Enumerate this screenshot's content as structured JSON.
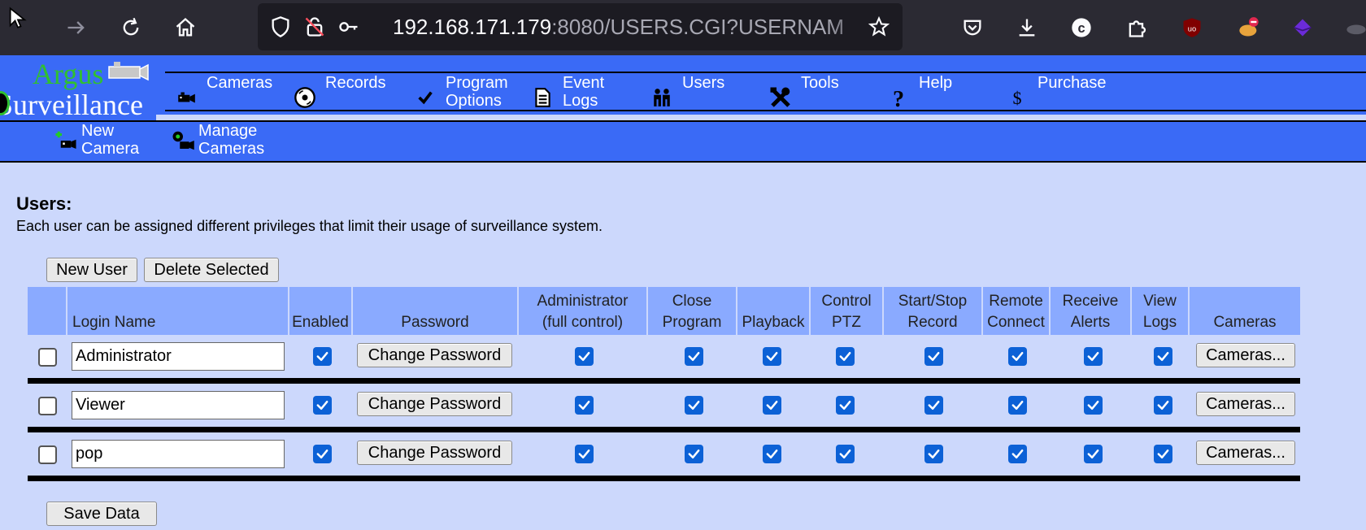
{
  "browser": {
    "url_host": "192.168.171.179",
    "url_path": ":8080/USERS.CGI?USERNAM"
  },
  "app": {
    "logo_line1": "Argus",
    "logo_line2": "Surveillance"
  },
  "nav": {
    "main": [
      {
        "label1": "Cameras",
        "label2": ""
      },
      {
        "label1": "Records",
        "label2": ""
      },
      {
        "label1": "Program",
        "label2": "Options"
      },
      {
        "label1": "Event",
        "label2": "Logs"
      },
      {
        "label1": "Users",
        "label2": ""
      },
      {
        "label1": "Tools",
        "label2": ""
      },
      {
        "label1": "Help",
        "label2": ""
      },
      {
        "label1": "Purchase",
        "label2": ""
      }
    ],
    "sub": [
      {
        "label1": "New",
        "label2": "Camera"
      },
      {
        "label1": "Manage",
        "label2": "Cameras"
      }
    ]
  },
  "page": {
    "heading": "Users:",
    "description": "Each user can be assigned different privileges that limit their usage of surveillance system.",
    "new_user_label": "New User",
    "delete_selected_label": "Delete Selected",
    "save_label": "Save Data"
  },
  "table": {
    "headers": {
      "login": "Login Name",
      "enabled": "Enabled",
      "password": "Password",
      "admin_1": "Administrator",
      "admin_2": "(full control)",
      "close_1": "Close",
      "close_2": "Program",
      "playback": "Playback",
      "ptz_1": "Control",
      "ptz_2": "PTZ",
      "record_1": "Start/Stop",
      "record_2": "Record",
      "remote_1": "Remote",
      "remote_2": "Connect",
      "alerts_1": "Receive",
      "alerts_2": "Alerts",
      "logs_1": "View",
      "logs_2": "Logs",
      "cameras": "Cameras"
    },
    "change_password_label": "Change Password",
    "cameras_button_label": "Cameras...",
    "rows": [
      {
        "login": "Administrator",
        "selected": false,
        "enabled": true,
        "admin": true,
        "close": true,
        "playback": true,
        "ptz": true,
        "record": true,
        "remote": true,
        "alerts": true,
        "logs": true
      },
      {
        "login": "Viewer",
        "selected": false,
        "enabled": true,
        "admin": true,
        "close": true,
        "playback": true,
        "ptz": true,
        "record": true,
        "remote": true,
        "alerts": true,
        "logs": true
      },
      {
        "login": "pop",
        "selected": false,
        "enabled": true,
        "admin": true,
        "close": true,
        "playback": true,
        "ptz": true,
        "record": true,
        "remote": true,
        "alerts": true,
        "logs": true
      }
    ]
  }
}
